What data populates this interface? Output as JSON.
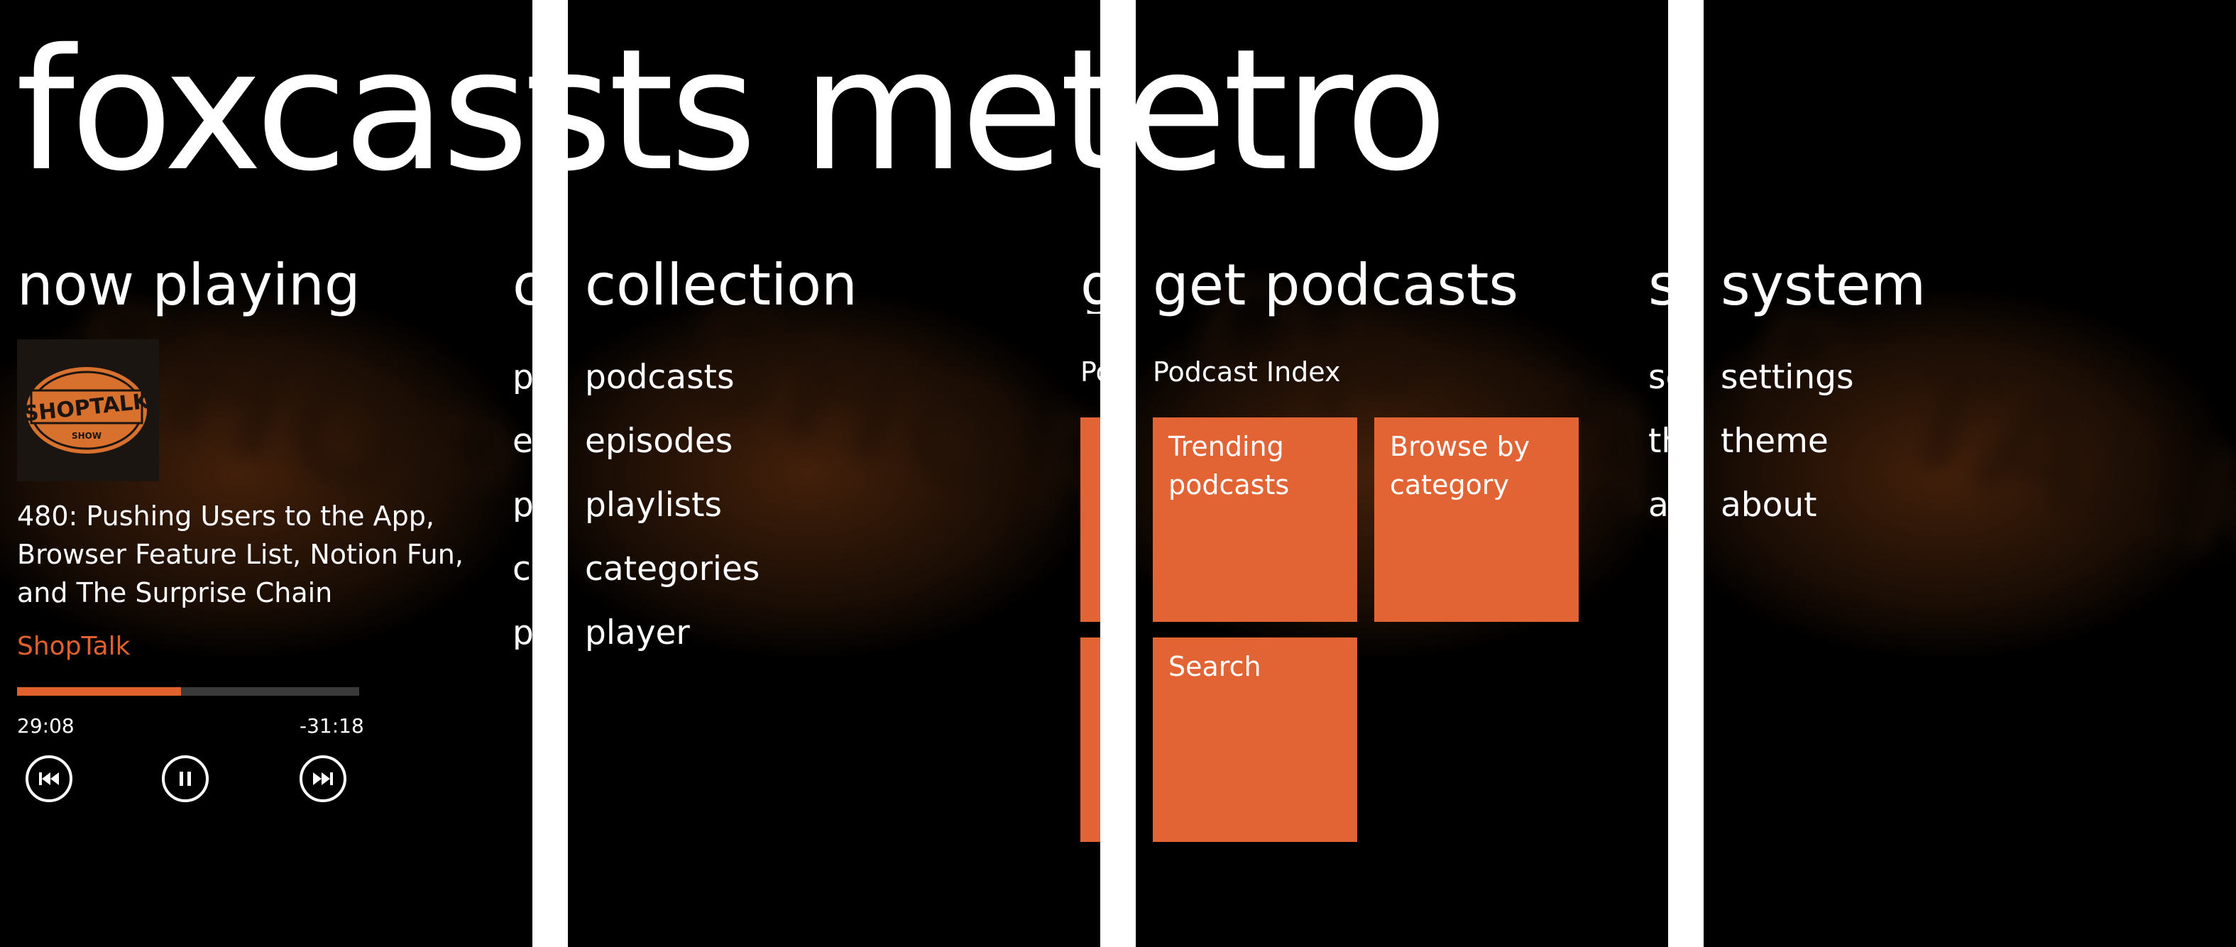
{
  "app_title": "foxcasts metro",
  "colors": {
    "accent": "#e26434",
    "background": "#000000",
    "text": "#ffffff",
    "progress_track": "#3a3a3a"
  },
  "now_playing": {
    "heading": "now playing",
    "album_art_text": "SHOPTALK",
    "album_art_subtext": "SHOW",
    "episode_title": "480: Pushing Users to the App, Browser Feature List, Notion Fun, and The Surprise Chain",
    "podcast_name": "ShopTalk",
    "progress_fraction": 0.48,
    "elapsed": "29:08",
    "remaining": "-31:18",
    "controls": [
      "skip-back-icon",
      "pause-icon",
      "skip-forward-icon"
    ]
  },
  "collection": {
    "heading": "collection",
    "items": [
      "podcasts",
      "episodes",
      "playlists",
      "categories",
      "player"
    ]
  },
  "get_podcasts": {
    "heading": "get podcasts",
    "subtitle": "Podcast Index",
    "tiles": [
      "Trending podcasts",
      "Browse by category",
      "Search"
    ]
  },
  "system": {
    "heading": "system",
    "items": [
      "settings",
      "theme",
      "about"
    ]
  }
}
